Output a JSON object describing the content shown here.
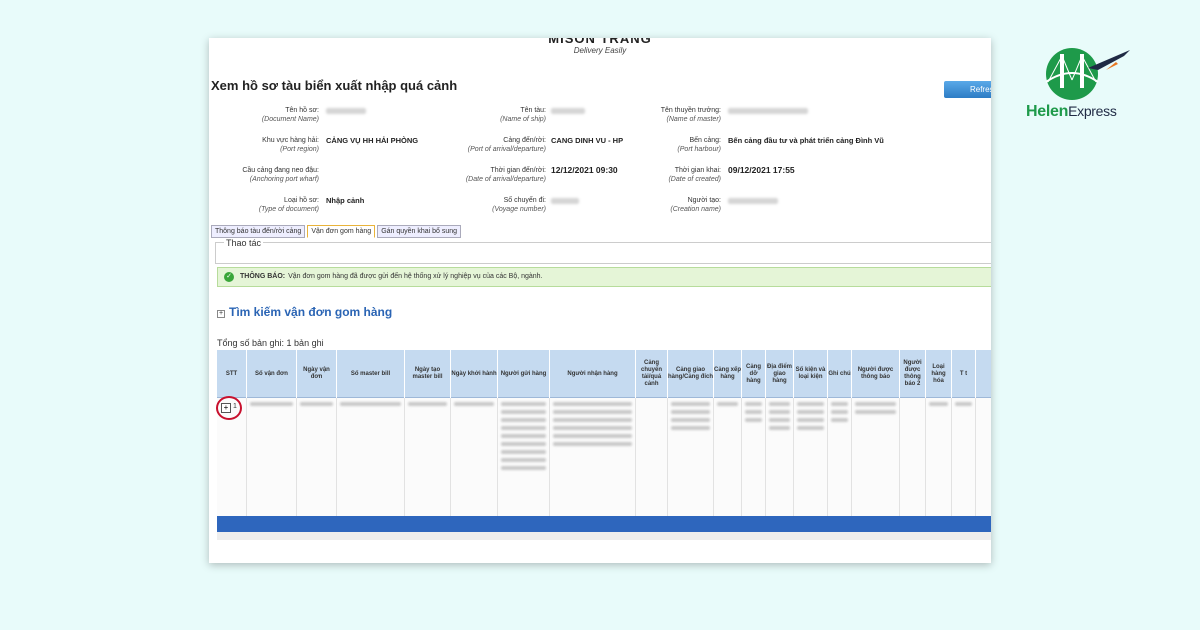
{
  "logo": {
    "brand_main": "Helen",
    "brand_sub": "Express"
  },
  "site": {
    "brand": "MISON TRANG",
    "tagline": "Delivery Easily"
  },
  "page": {
    "title": "Xem hồ sơ tàu biển xuất nhập quá cảnh",
    "refresh_label": "Refresh"
  },
  "info": {
    "doc_name_lbl": "Tên hồ sơ:",
    "doc_name_en": "(Document Name)",
    "ship_name_lbl": "Tên tàu:",
    "ship_name_en": "(Name of ship)",
    "master_lbl": "Tên thuyền trưởng:",
    "master_en": "(Name of master)",
    "port_region_lbl": "Khu vực hàng hải:",
    "port_region_en": "(Port region)",
    "port_region_val": "CẢNG VỤ HH HẢI PHÒNG",
    "port_arr_lbl": "Cảng đến/rời:",
    "port_arr_en": "(Port of arrival/departure)",
    "port_arr_val": "CANG DINH VU - HP",
    "harbour_lbl": "Bến cảng:",
    "harbour_en": "(Port harbour)",
    "harbour_val": "Bến cảng đầu tư và phát triển cảng Đình Vũ",
    "wharf_lbl": "Cầu cảng đang neo đậu:",
    "wharf_en": "(Anchoring port wharf)",
    "date_arr_lbl": "Thời gian đến/rời:",
    "date_arr_en": "(Date of arrival/departure)",
    "date_arr_val": "12/12/2021 09:30",
    "date_created_lbl": "Thời gian khai:",
    "date_created_en": "(Date of created)",
    "date_created_val": "09/12/2021 17:55",
    "doc_type_lbl": "Loại hồ sơ:",
    "doc_type_en": "(Type of document)",
    "doc_type_val": "Nhập cảnh",
    "voyage_lbl": "Số chuyến đi:",
    "voyage_en": "(Voyage number)",
    "creator_lbl": "Người tạo:",
    "creator_en": "(Creation name)"
  },
  "tabs": [
    "Thông báo tàu đến/rời cảng",
    "Vận đơn gom hàng",
    "Gán quyền khai bổ sung"
  ],
  "section": {
    "thaotac": "Thao tác"
  },
  "notice": {
    "label": "THÔNG BÁO:",
    "text": "Vận đơn gom hàng đã được gửi đến hệ thống xử lý nghiệp vụ của các Bộ, ngành."
  },
  "search": {
    "title": "Tìm kiếm vận đơn gom hàng",
    "total": "Tổng số bản ghi: 1 bản ghi"
  },
  "table": {
    "headers": [
      "STT",
      "Số vận đơn",
      "Ngày vận đơn",
      "Số master bill",
      "Ngày tạo master bill",
      "Ngày khởi hành",
      "Người gửi hàng",
      "Người nhận hàng",
      "Cảng chuyển tải/quá cảnh",
      "Cảng giao hàng/Cảng đích",
      "Cảng xếp hàng",
      "Cảng dỡ hàng",
      "Địa điểm giao hàng",
      "Số kiện và loại kiện",
      "Ghi chú",
      "Người được thông báo",
      "Người được thông báo 2",
      "Loại hàng hóa",
      "T t"
    ],
    "row_stt": "1",
    "expand_symbol": "+"
  }
}
